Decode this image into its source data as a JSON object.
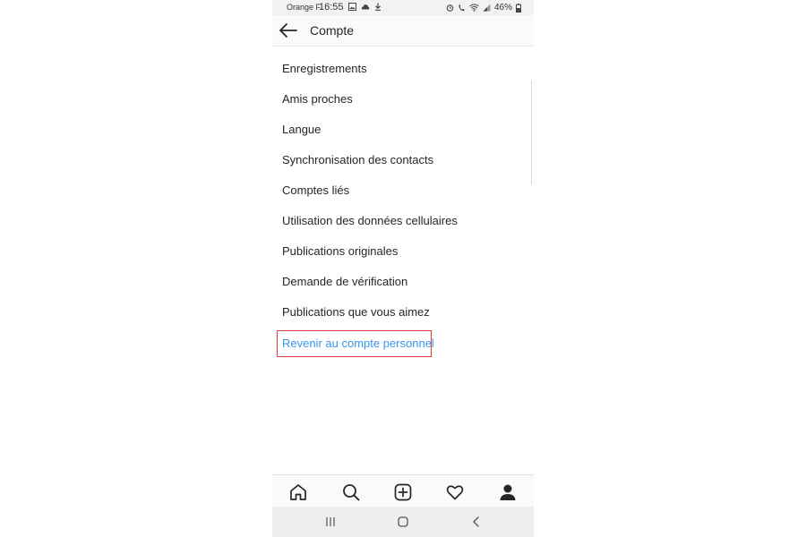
{
  "status_bar": {
    "carrier": "Orange F",
    "time": "16:55",
    "battery": "46%",
    "left_icons": [
      "image-icon",
      "cloud-icon",
      "download-icon"
    ],
    "right_icons": [
      "alarm-icon",
      "wifi-call-icon",
      "wifi-icon",
      "signal-icon",
      "battery-icon"
    ]
  },
  "header": {
    "back_icon": "arrow-left-icon",
    "title": "Compte"
  },
  "menu": {
    "items": [
      {
        "label": "Enregistrements"
      },
      {
        "label": "Amis proches"
      },
      {
        "label": "Langue"
      },
      {
        "label": "Synchronisation des contacts"
      },
      {
        "label": "Comptes liés"
      },
      {
        "label": "Utilisation des données cellulaires"
      },
      {
        "label": "Publications originales"
      },
      {
        "label": "Demande de vérification"
      },
      {
        "label": "Publications que vous aimez"
      }
    ],
    "switch_link": {
      "label": "Revenir au compte personnel",
      "color": "#3897f0"
    },
    "highlight_color": "#e03a3a"
  },
  "bottom_nav": {
    "items": [
      "home-icon",
      "search-icon",
      "add-post-icon",
      "heart-icon",
      "profile-icon"
    ]
  },
  "system_nav": {
    "items": [
      "recent-apps-icon",
      "home-button-icon",
      "back-icon"
    ]
  }
}
